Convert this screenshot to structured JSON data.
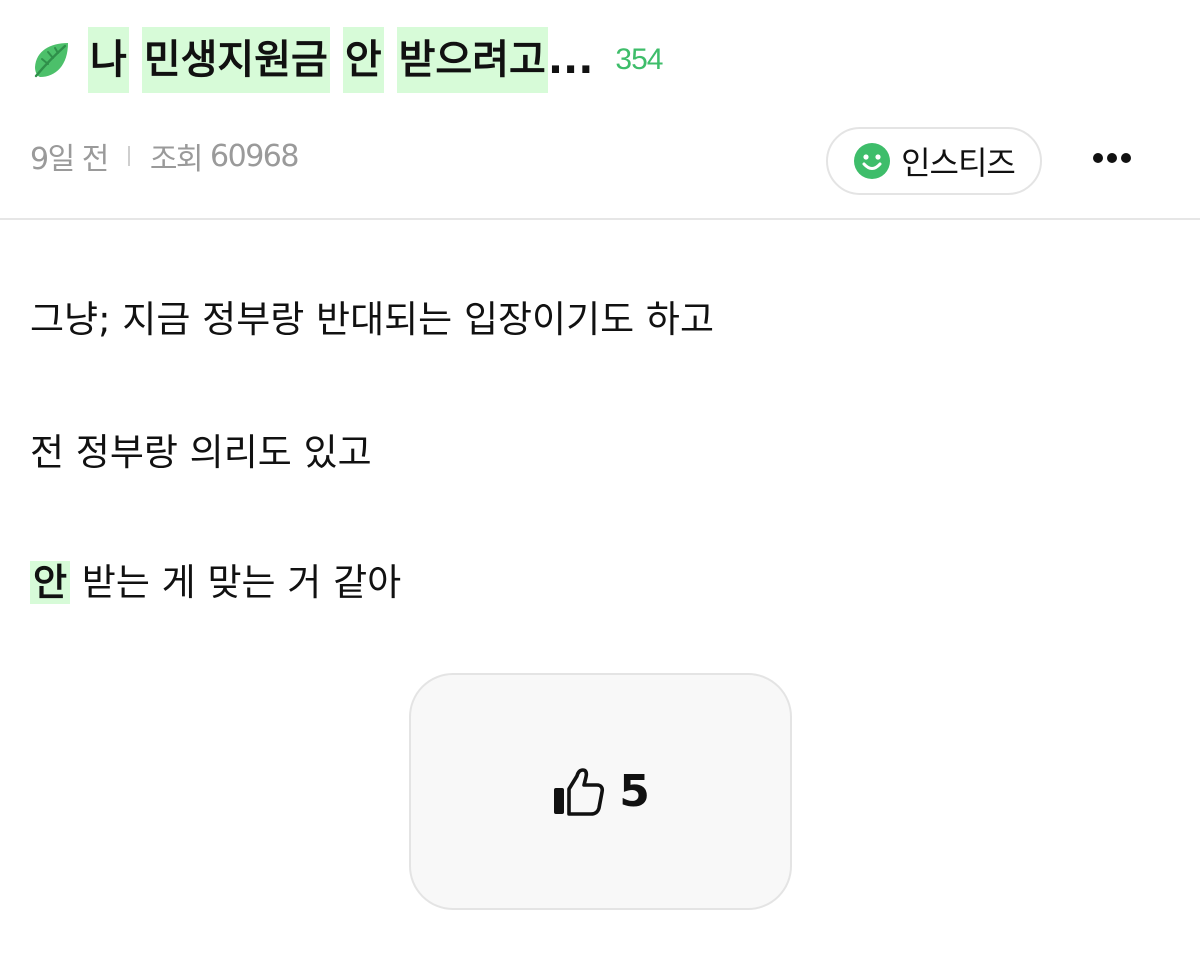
{
  "post": {
    "title_parts": [
      "나",
      "민생지원금",
      "안",
      "받으려고"
    ],
    "title_ellipsis": "...",
    "comment_count": "354",
    "time_ago": "9일 전",
    "views_label": "조회",
    "views_count": "60968",
    "board_name": "인스티즈",
    "body": {
      "line1": "그냥; 지금 정부랑 반대되는 입장이기도 하고",
      "line2": "전 정부랑 의리도 있고",
      "line3_highlight": "안",
      "line3_rest": " 받는 게 맞는 거 같아"
    },
    "like_count": "5"
  },
  "icons": {
    "title_icon": "leaf-icon",
    "board_icon": "smile-icon",
    "more_icon": "more-dots-icon",
    "like_icon": "thumbs-up-icon"
  },
  "colors": {
    "highlight": "#d7fbd8",
    "accent_green": "#3ebd6a",
    "meta_gray": "#9a9a9a"
  }
}
